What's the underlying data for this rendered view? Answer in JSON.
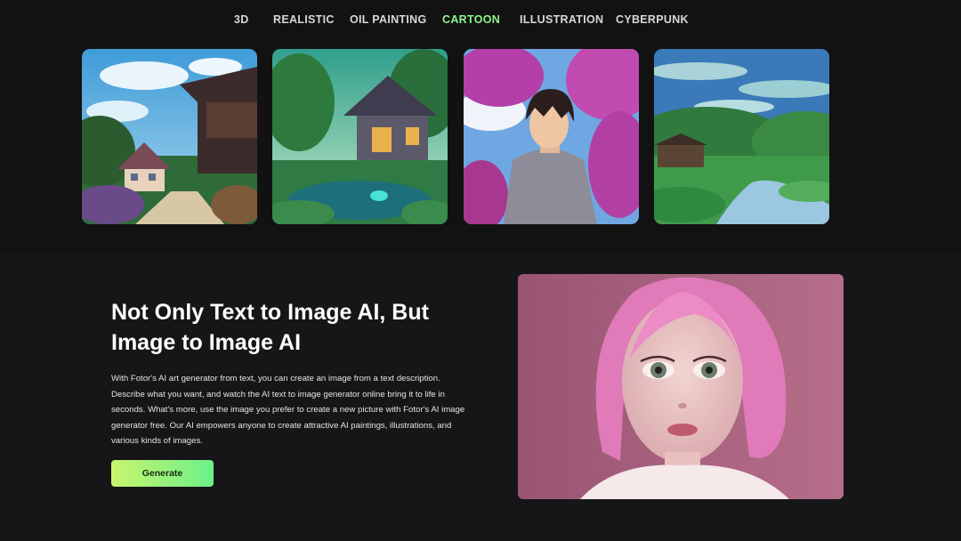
{
  "tabs": [
    {
      "label": "3D"
    },
    {
      "label": "REALISTIC"
    },
    {
      "label": "OIL PAINTING"
    },
    {
      "label": "CARTOON"
    },
    {
      "label": "ILLUSTRATION"
    },
    {
      "label": "CYBERPUNK"
    }
  ],
  "active_tab": "CARTOON",
  "colors": {
    "accent": "#8ef58d",
    "background": "#161618",
    "button_from": "#c9f56d",
    "button_to": "#6cf089"
  },
  "gallery": [
    {
      "subject": "cartoon village street with house"
    },
    {
      "subject": "cartoon cottage by a pond"
    },
    {
      "subject": "anime boy under cherry blossoms"
    },
    {
      "subject": "cartoon landscape with river and hut"
    }
  ],
  "feature": {
    "title_line1": "Not Only Text to Image AI, But",
    "title_line2": "Image to Image AI",
    "description": "With Fotor's AI art generator from text, you can create an image from a text description. Describe what you want, and watch the AI text to image generator online bring it to life in seconds. What's more, use the image you prefer to create a new picture with Fotor's AI image generator free. Our AI empowers anyone to create attractive AI paintings, illustrations, and various kinds of images.",
    "button_label": "Generate",
    "portrait_subject": "pink-haired girl portrait"
  }
}
